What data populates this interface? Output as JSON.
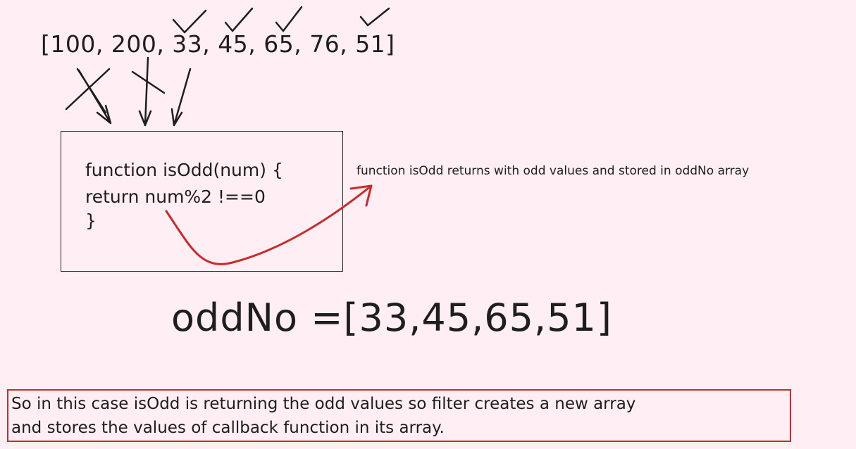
{
  "array_input": "[100, 200, 33, 45, 65, 76, 51]",
  "code": {
    "line1": "function isOdd(num) {",
    "line2": "return num%2 !==0",
    "line3": "}"
  },
  "note": "function isOdd returns with odd values and stored in oddNo array",
  "result": "oddNo =[33,45,65,51]",
  "summary": {
    "line1": "So in this case isOdd is returning the odd values so filter creates a new array",
    "line2": "and stores the values of callback function in its array."
  },
  "colors": {
    "background": "#ffeef3",
    "ink": "#1e1e1e",
    "accent_red": "#c92a2a"
  },
  "marks": {
    "checkmarks": [
      "33",
      "45",
      "65",
      "51"
    ],
    "crossed_out": [
      "100",
      "200"
    ]
  }
}
